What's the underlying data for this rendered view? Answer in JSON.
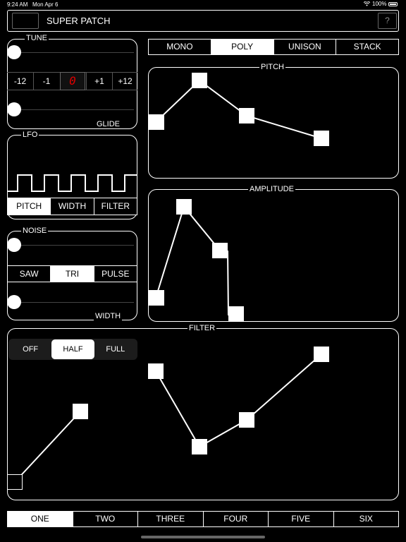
{
  "status_bar": {
    "time": "9:24 AM",
    "date": "Mon Apr 6",
    "battery": "100%",
    "icons": [
      "wifi-icon",
      "battery-icon"
    ]
  },
  "header": {
    "title": "SUPER PATCH",
    "help_label": "?"
  },
  "tune": {
    "label": "TUNE",
    "glide_label": "GLIDE",
    "buttons": [
      "-12",
      "-1",
      "+1",
      "+12"
    ],
    "display": "0",
    "tune_level": 0.0,
    "glide_level": 0.0
  },
  "voice_modes": {
    "items": [
      "MONO",
      "POLY",
      "UNISON",
      "STACK"
    ],
    "selected": "POLY"
  },
  "lfo": {
    "label": "LFO",
    "targets": [
      "PITCH",
      "WIDTH",
      "FILTER"
    ],
    "selected": "PITCH"
  },
  "noise": {
    "label": "NOISE",
    "width_label": "WIDTH",
    "waves": [
      "SAW",
      "TRI",
      "PULSE"
    ],
    "selected": "TRI",
    "noise_level": 0.0,
    "width_level": 0.0
  },
  "pitch_env": {
    "label": "PITCH"
  },
  "amp_env": {
    "label": "AMPLITUDE"
  },
  "filter": {
    "label": "FILTER",
    "modes": [
      "OFF",
      "HALF",
      "FULL"
    ],
    "selected": "HALF"
  },
  "patches": {
    "items": [
      "ONE",
      "TWO",
      "THREE",
      "FOUR",
      "FIVE",
      "SIX"
    ],
    "selected": "ONE"
  },
  "colors": {
    "background": "#000000",
    "foreground": "#ffffff",
    "segment_display": "#e00000"
  }
}
